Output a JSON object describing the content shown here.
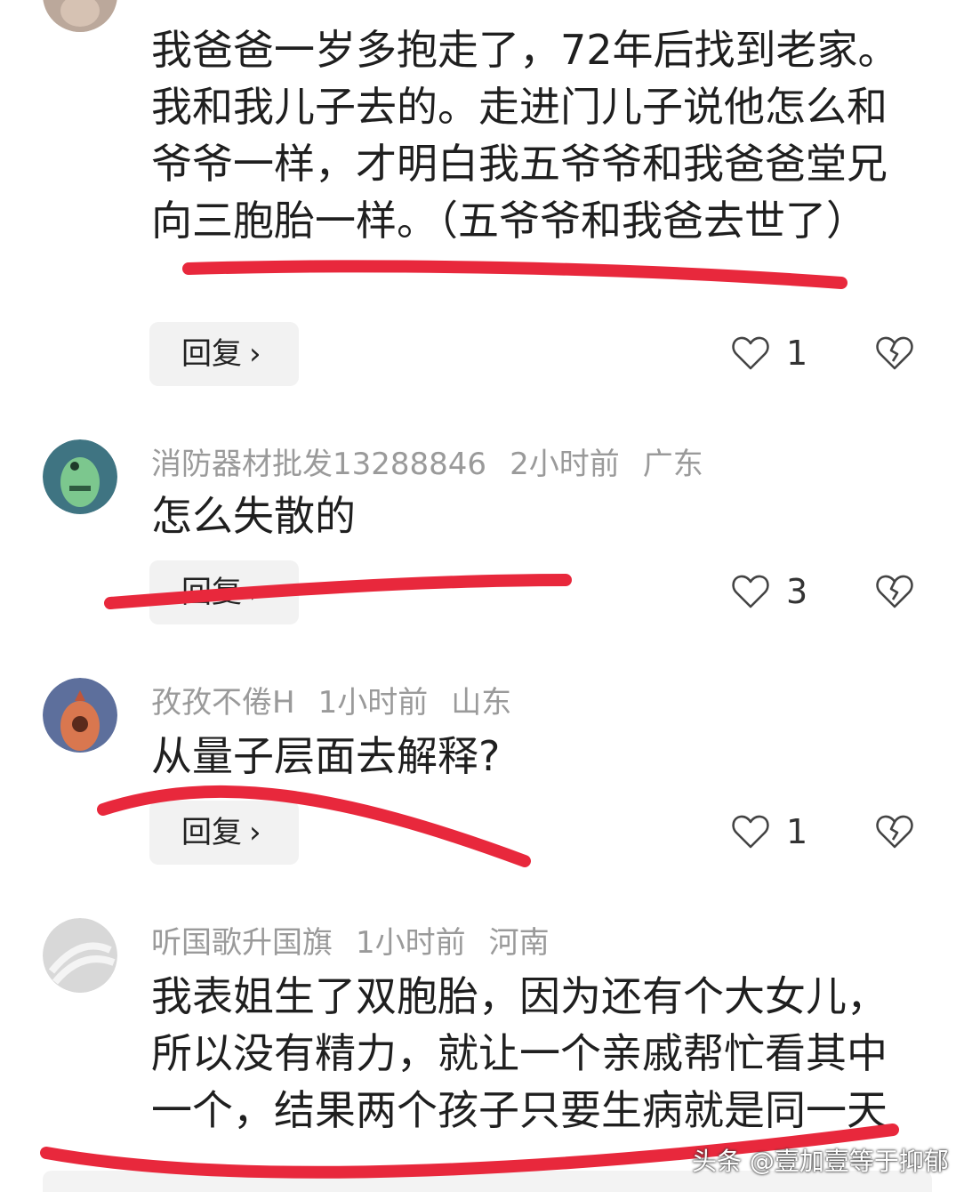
{
  "comments": [
    {
      "text": "我爸爸一岁多抱走了，72年后找到老家。我和我儿子去的。走进门儿子说他怎么和爷爷一样，才明白我五爷爷和我爸爸堂兄向三胞胎一样。（五爷爷和我爸去世了）",
      "reply_label": "回复",
      "likes": "1"
    },
    {
      "username": "消防器材批发13288846",
      "time": "2小时前",
      "location": "广东",
      "text": "怎么失散的",
      "reply_label": "回复",
      "likes": "3"
    },
    {
      "username": "孜孜不倦H",
      "time": "1小时前",
      "location": "山东",
      "text": "从量子层面去解释?",
      "reply_label": "回复",
      "likes": "1"
    },
    {
      "username": "听国歌升国旗",
      "time": "1小时前",
      "location": "河南",
      "text": "我表姐生了双胞胎，因为还有个大女儿，所以没有精力，就让一个亲戚帮忙看其中一个，结果两个孩子只要生病就是同一天"
    }
  ],
  "watermark": "头条 @壹加壹等于抑郁",
  "icons": {
    "like": "heart-icon",
    "dislike": "broken-heart-icon",
    "reply_chevron": "chevron-right-icon"
  },
  "colors": {
    "annotation_red": "#e8283c",
    "meta_gray": "#9a9a9a",
    "reply_bg": "#f2f2f2"
  }
}
